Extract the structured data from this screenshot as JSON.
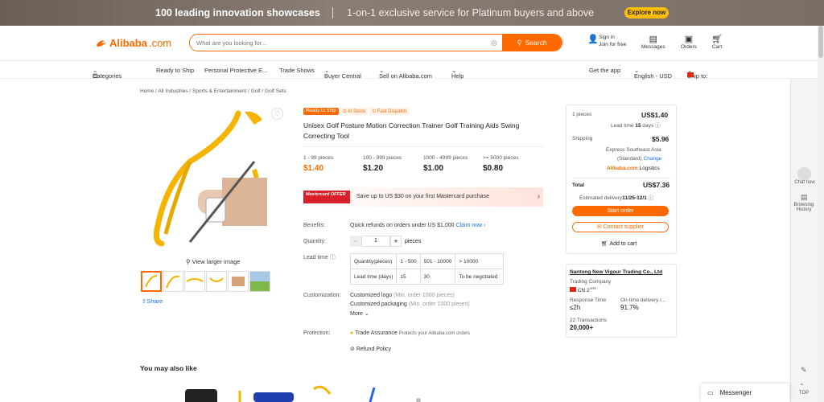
{
  "banner": {
    "headline": "100 leading innovation showcases",
    "subline": "1-on-1 exclusive service for Platinum buyers and above",
    "cta": "Explore now"
  },
  "header": {
    "logo": "Alibaba",
    "logo_domain": ".com",
    "search_placeholder": "What are you looking for...",
    "search_button": "Search",
    "sign_in": "Sign in",
    "join": "Join for free",
    "messages": "Messages",
    "orders": "Orders",
    "cart": "Cart"
  },
  "nav": {
    "categories": "Categories",
    "items": [
      "Ready to Ship",
      "Personal Protective E...",
      "Trade Shows",
      "Buyer Central",
      "Sell on Alibaba.com",
      "Help"
    ],
    "get_app": "Get the app",
    "language": "English - USD",
    "ship_to": "Ship to:"
  },
  "breadcrumb": [
    "Home",
    "All Industries",
    "Sports & Entertainment",
    "Golf",
    "Golf Sets"
  ],
  "gallery": {
    "view_larger": "View larger image",
    "share": "Share"
  },
  "product": {
    "badge_ready": "Ready to Ship",
    "badge_stock": "In Stock",
    "badge_dispatch": "Fast Dispatch",
    "title": "Unisex Golf Posture Motion Correction Trainer Golf Training Aids Swing Correcting Tool",
    "tiers": [
      {
        "range": "1 - 99 pieces",
        "price": "$1.40"
      },
      {
        "range": "100 - 999 pieces",
        "price": "$1.20"
      },
      {
        "range": "1000 - 4999 pieces",
        "price": "$1.00"
      },
      {
        "range": ">= 5000 pieces",
        "price": "$0.80"
      }
    ],
    "mastercard_tag": "Mastercard OFFER",
    "mastercard_text": "Save up to US $30 on your first Mastercard purchase",
    "benefits_label": "Benefits:",
    "benefits_text": "Quick refunds on orders under US $1,000",
    "benefits_link": "Claim now",
    "quantity_label": "Quantity:",
    "quantity_value": "1",
    "quantity_unit": "pieces",
    "lead_label": "Lead time",
    "lead_table": [
      [
        "Quantity(pieces)",
        "1 - 500",
        "501 - 10000",
        "> 10000"
      ],
      [
        "Lead time (days)",
        "15",
        "30",
        "To be negotiated"
      ]
    ],
    "custom_label": "Customization:",
    "custom_logo": "Customized logo",
    "custom_logo_min": "(Min. order 1000 pieces)",
    "custom_pack": "Customized packaging",
    "custom_pack_min": "(Min. order 1000 pieces)",
    "more": "More",
    "protection_label": "Protection:",
    "trade_assurance": "Trade Assurance",
    "trade_assurance_desc": "Protects your Alibaba.com orders",
    "refund": "Refund Policy"
  },
  "order_box": {
    "pieces": "1 pieces",
    "unit_price": "US$1.40",
    "lead_text": "Lead time",
    "lead_days": "15",
    "lead_unit": "days",
    "shipping_label": "Shipping",
    "shipping_price": "$5.96",
    "shipping_method": "Express Southeast Asia",
    "shipping_std": "(Standard)",
    "change": "Change",
    "logistics": "Logistics",
    "total_label": "Total",
    "total_price": "US$7.36",
    "delivery_label": "Estimated delivery",
    "delivery_dates": "11/25-12/1",
    "start_order": "Start order",
    "contact": "Contact supplier",
    "add_cart": "Add to cart"
  },
  "supplier": {
    "name": "Nantong New Vigour Trading Co., Ltd",
    "type": "Trading Company",
    "country": "CN",
    "years": "2",
    "years_unit": "YRS",
    "response_label": "Response Time",
    "response_value": "≤2h",
    "ontime_label": "On-time delivery r...",
    "ontime_value": "91.7%",
    "transactions_label": "22 Transactions",
    "transactions_value": "20,000+"
  },
  "sidebar": {
    "chat": "Chat now",
    "browsing": "Browsing History",
    "top": "TOP"
  },
  "you_may_like": "You may also like",
  "messenger": "Messenger"
}
